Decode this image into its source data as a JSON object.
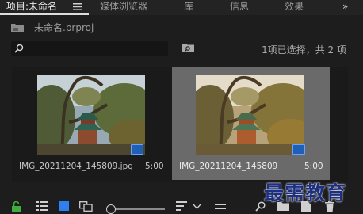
{
  "tabs": [
    {
      "label": "项目:未命名",
      "active": true
    },
    {
      "label": "媒体浏览器",
      "active": false
    },
    {
      "label": "库",
      "active": false
    },
    {
      "label": "信息",
      "active": false
    },
    {
      "label": "效果",
      "active": false
    }
  ],
  "overflow_label": "»",
  "project": {
    "file_name": "未命名.prproj"
  },
  "search": {
    "value": ""
  },
  "selection_status": "1项已选择，共 2 项",
  "items": [
    {
      "name": "IMG_20211204_145809.jpg",
      "duration": "5:00",
      "selected": false,
      "badge_icon": "image-sequence-icon"
    },
    {
      "name": "IMG_20211204_145809",
      "duration": "5:00",
      "selected": true,
      "badge_icon": "sequence-icon"
    }
  ],
  "watermark": "最需教育",
  "colors": {
    "accent_blue": "#1f5fb4",
    "lock_green": "#3fae3f",
    "selected_bg": "#6a6a6a"
  }
}
